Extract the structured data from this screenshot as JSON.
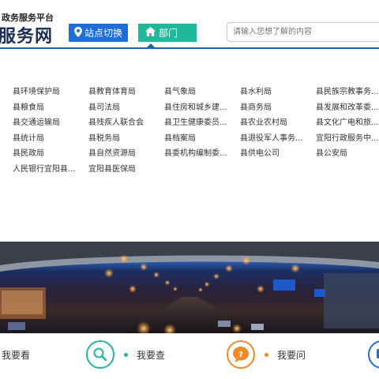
{
  "header": {
    "subtitle": "政务服务平台",
    "title": "服务网",
    "site_switch_label": "站点切换",
    "dept_label": "部门",
    "search_placeholder": "请输入您想了解的内容"
  },
  "departments": [
    "县环境保护局",
    "县教育体育局",
    "县气象局",
    "县水利局",
    "县民族宗教事务...",
    "县粮食局",
    "县司法局",
    "县住房和城乡建...",
    "县商务局",
    "县发展和改革委...",
    "县交通运输局",
    "县残疾人联合会",
    "县卫生健康委员...",
    "县农业农村局",
    "县文化广电和旅...",
    "县统计局",
    "县税务局",
    "县档案局",
    "县退役军人事务...",
    "宜阳行政服务中...",
    "县民政局",
    "县自然资源局",
    "县委机构编制委...",
    "县供电公司",
    "县公安局",
    "人民银行宜阳县...",
    "宜阳县医保局"
  ],
  "bottom_nav": [
    {
      "label": "我要看",
      "icon": "view-icon",
      "color": "#1fb89a"
    },
    {
      "label": "我要查",
      "icon": "search-icon",
      "color": "#1fb89a"
    },
    {
      "label": "我要问",
      "icon": "question-icon",
      "color": "#f08a24"
    },
    {
      "label": "",
      "icon": "complaint-icon",
      "color": "#1e6ed8"
    }
  ],
  "colors": {
    "primary_blue": "#1e6ed8",
    "teal": "#1fb89a",
    "orange": "#f08a24",
    "header_rule": "#1f63b8"
  }
}
